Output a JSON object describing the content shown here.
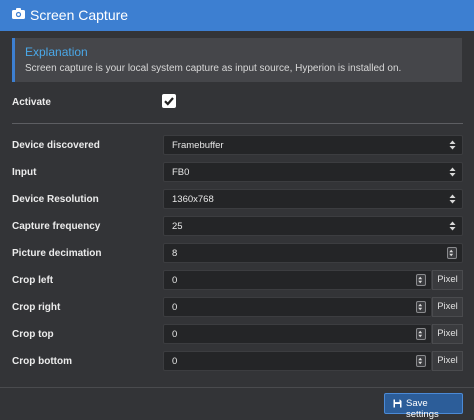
{
  "header": {
    "title": "Screen Capture",
    "icon": "camera-icon"
  },
  "explanation": {
    "title": "Explanation",
    "text": "Screen capture is your local system capture as input source, Hyperion is installed on."
  },
  "activate": {
    "label": "Activate",
    "checked": true
  },
  "fields": {
    "device": {
      "label": "Device discovered",
      "value": "Framebuffer"
    },
    "input": {
      "label": "Input",
      "value": "FB0"
    },
    "resolution": {
      "label": "Device Resolution",
      "value": "1360x768"
    },
    "frequency": {
      "label": "Capture frequency",
      "value": "25"
    },
    "decimation": {
      "label": "Picture decimation",
      "value": "8"
    },
    "crop_left": {
      "label": "Crop left",
      "value": "0",
      "unit": "Pixel"
    },
    "crop_right": {
      "label": "Crop right",
      "value": "0",
      "unit": "Pixel"
    },
    "crop_top": {
      "label": "Crop top",
      "value": "0",
      "unit": "Pixel"
    },
    "crop_bottom": {
      "label": "Crop bottom",
      "value": "0",
      "unit": "Pixel"
    }
  },
  "footer": {
    "save_label": "Save settings"
  },
  "colors": {
    "accent": "#3d7fd1",
    "background": "#333437",
    "field": "#242527",
    "info_title": "#4aa8e8"
  }
}
